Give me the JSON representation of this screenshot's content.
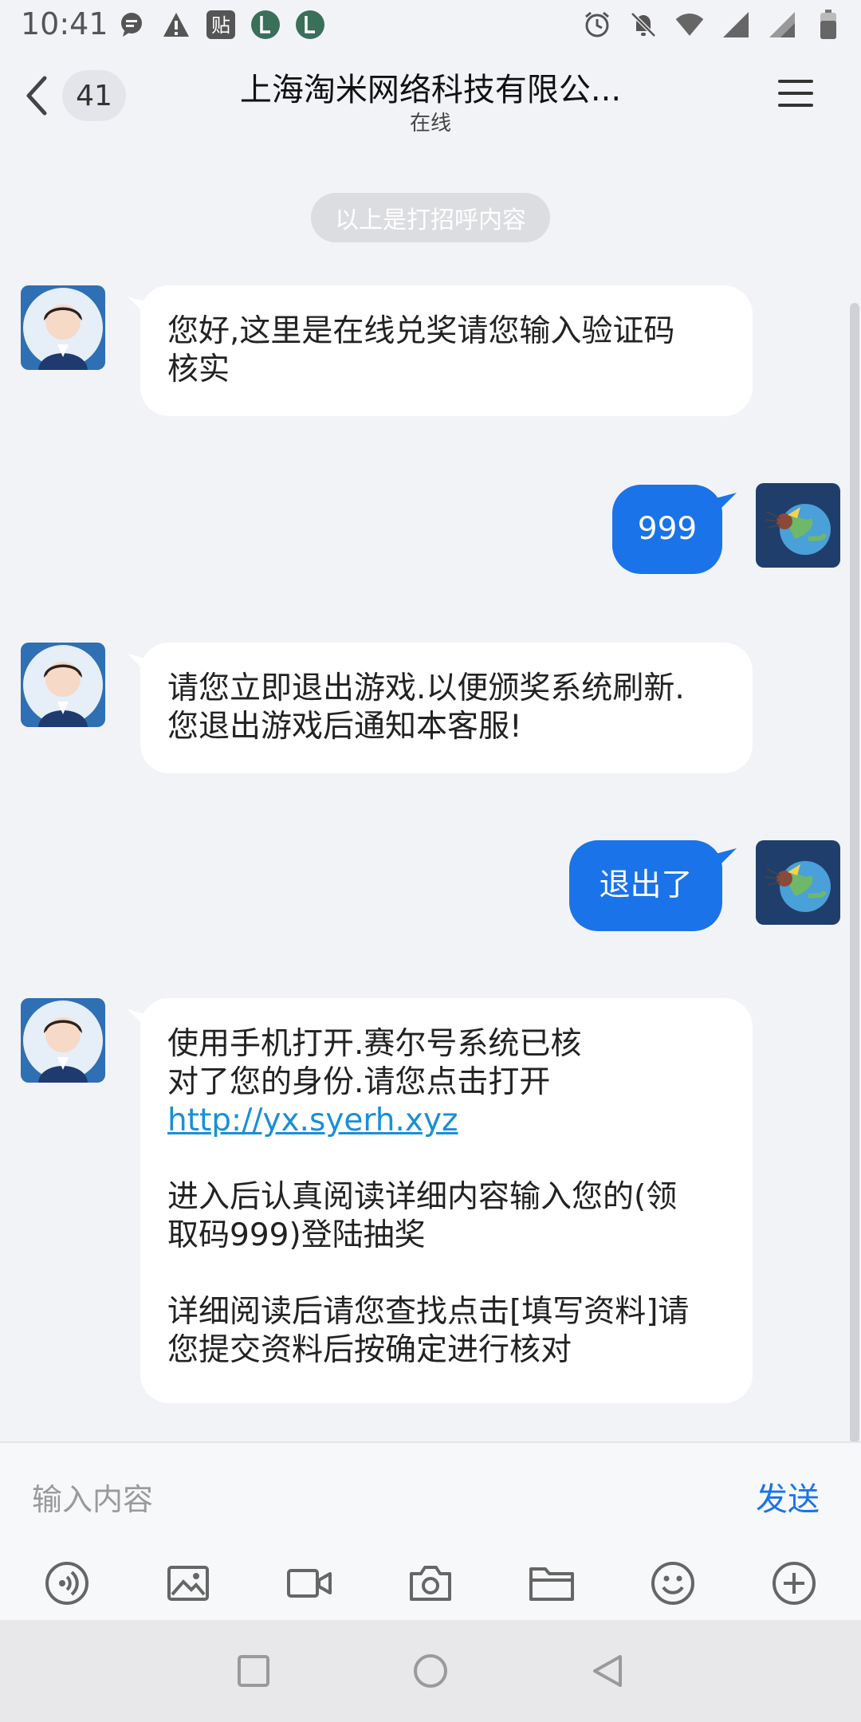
{
  "status_bar": {
    "time": "10:41",
    "left_icons": [
      "message-icon",
      "warning-icon",
      "sticker-app-icon",
      "app-l-icon",
      "app-l-icon"
    ],
    "right_icons": [
      "alarm-icon",
      "bell-muted-icon",
      "wifi-icon",
      "signal-icon",
      "signal-icon",
      "battery-icon"
    ]
  },
  "header": {
    "unread_count": "41",
    "title": "上海淘米网络科技有限公...",
    "subtitle": "在线"
  },
  "notice": "以上是打招呼内容",
  "messages": [
    {
      "side": "in",
      "lines": [
        "您好,这里是在线兑奖请您输入验证码",
        "核实"
      ]
    },
    {
      "side": "out",
      "text": "999"
    },
    {
      "side": "in",
      "lines": [
        "请您立即退出游戏.以便颁奖系统刷新.",
        "您退出游戏后通知本客服!"
      ]
    },
    {
      "side": "out",
      "text": "退出了"
    },
    {
      "side": "in",
      "line1": "使用手机打开.赛尔号系统已核",
      "line2": "对了您的身份.请您点击打开",
      "link": "http://yx.syerh.xyz",
      "para2_l1": "进入后认真阅读详细内容输入您的(领",
      "para2_l2": "取码999)登陆抽奖",
      "para3_l1": "详细阅读后请您查找点击[填写资料]请",
      "para3_l2": "您提交资料后按确定进行核对"
    }
  ],
  "input": {
    "placeholder": "输入内容",
    "send_label": "发送"
  },
  "toolbar_icons": [
    "voice-icon",
    "image-icon",
    "video-icon",
    "camera-icon",
    "folder-icon",
    "emoji-icon",
    "plus-icon"
  ],
  "colors": {
    "accent": "#1a73e8",
    "link": "#1a8fd6",
    "background": "#f2f3f7"
  }
}
